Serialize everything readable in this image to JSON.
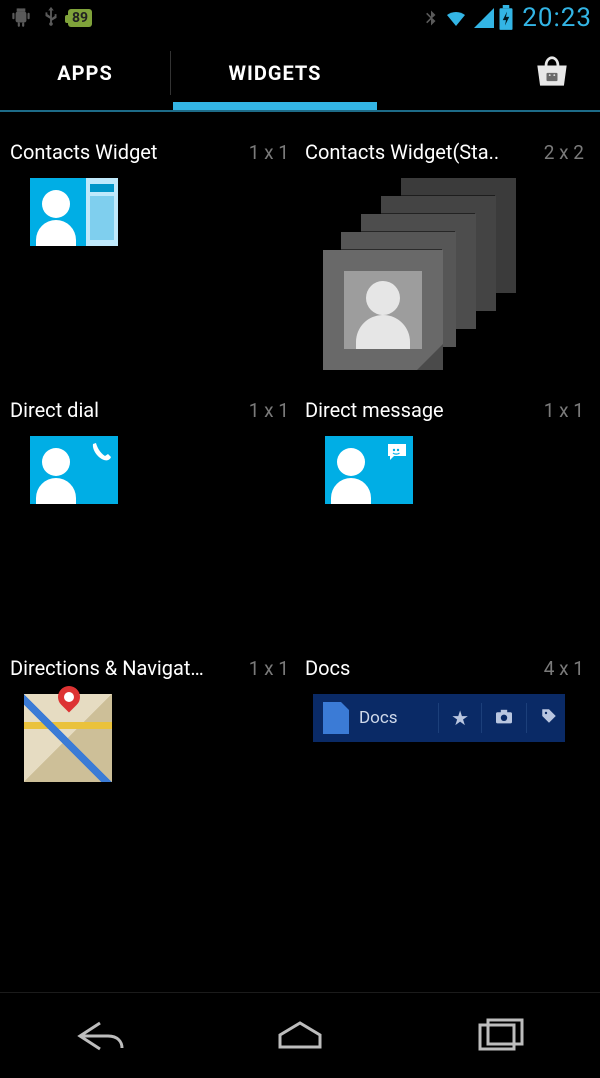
{
  "status": {
    "battery_badge": "89",
    "time": "20:23"
  },
  "tabs": {
    "apps": "APPS",
    "widgets": "WIDGETS",
    "active": "widgets"
  },
  "widgets": [
    {
      "title": "Contacts Widget",
      "dim": "1 x 1"
    },
    {
      "title": "Contacts Widget(Sta..",
      "dim": "2 x 2"
    },
    {
      "title": "Direct dial",
      "dim": "1 x 1"
    },
    {
      "title": "Direct message",
      "dim": "1 x 1"
    },
    {
      "title": "Directions & Navigati..",
      "dim": "1 x 1"
    },
    {
      "title": "Docs",
      "dim": "4 x 1"
    }
  ],
  "docs_widget": {
    "label": "Docs"
  }
}
